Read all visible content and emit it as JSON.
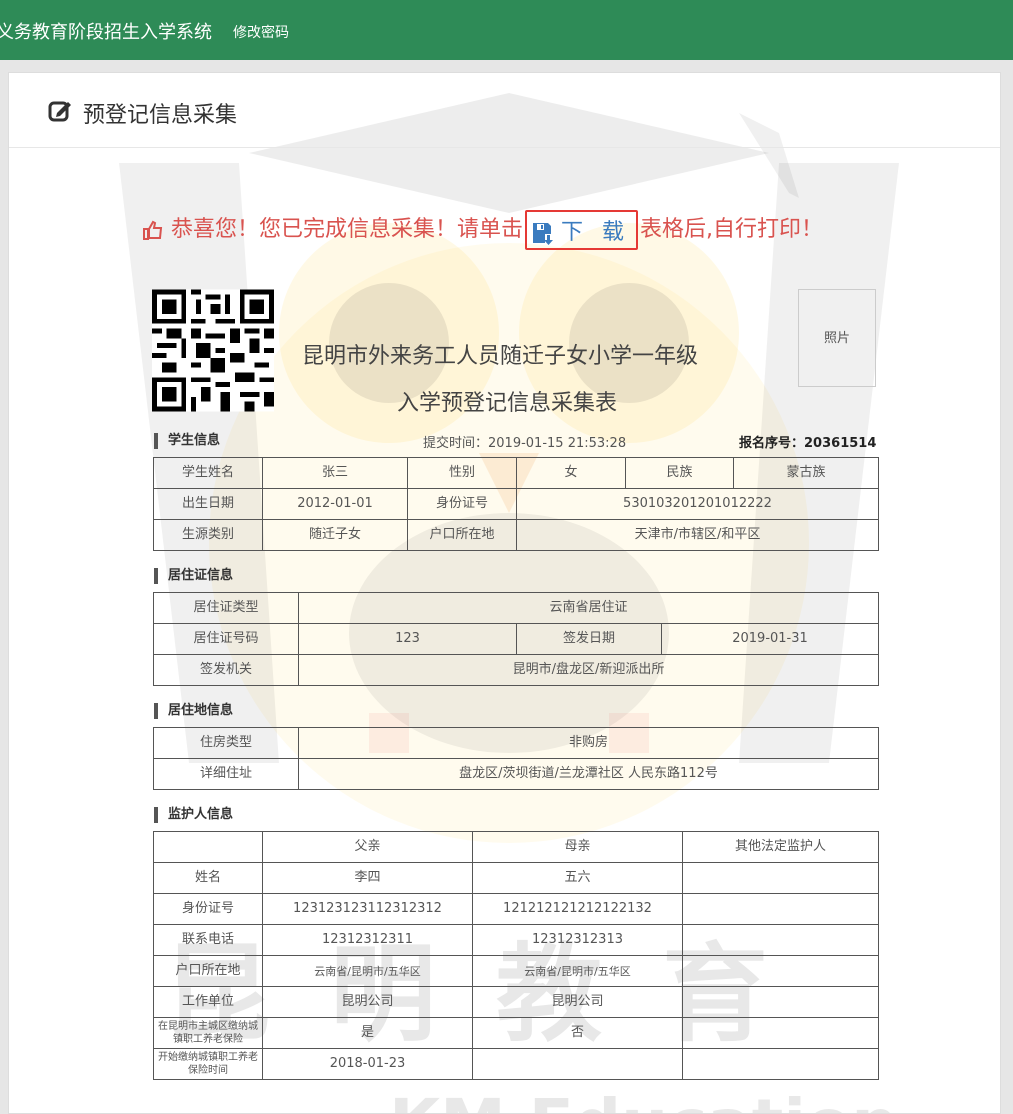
{
  "app": {
    "title": "义务教育阶段招生入学系统",
    "nav_change_password": "修改密码"
  },
  "panel": {
    "title": "预登记信息采集"
  },
  "notice": {
    "before": "恭喜您！您已完成信息采集！请单击",
    "download_label": "下 载",
    "after": "表格后,自行打印！"
  },
  "form": {
    "title_line1": "昆明市外来务工人员随迁子女小学一年级",
    "title_line2": "入学预登记信息采集表",
    "photo_label": "照片",
    "submit_time_label": "提交时间：",
    "submit_time": "2019-01-15 21:53:28",
    "reg_no_label": "报名序号：",
    "reg_no": "20361514"
  },
  "student": {
    "section": "学生信息",
    "name_label": "学生姓名",
    "name": "张三",
    "gender_label": "性别",
    "gender": "女",
    "ethnicity_label": "民族",
    "ethnicity": "蒙古族",
    "birth_label": "出生日期",
    "birth": "2012-01-01",
    "id_label": "身份证号",
    "id": "530103201201012222",
    "source_label": "生源类别",
    "source": "随迁子女",
    "hukou_label": "户口所在地",
    "hukou": "天津市/市辖区/和平区"
  },
  "permit": {
    "section": "居住证信息",
    "type_label": "居住证类型",
    "type": "云南省居住证",
    "number_label": "居住证号码",
    "number": "123",
    "issue_date_label": "签发日期",
    "issue_date": "2019-01-31",
    "authority_label": "签发机关",
    "authority": "昆明市/盘龙区/新迎派出所"
  },
  "residence": {
    "section": "居住地信息",
    "housing_label": "住房类型",
    "housing": "非购房",
    "address_label": "详细住址",
    "address": "盘龙区/茨坝街道/兰龙潭社区 人民东路112号"
  },
  "guardian": {
    "section": "监护人信息",
    "col_father": "父亲",
    "col_mother": "母亲",
    "col_other": "其他法定监护人",
    "rows": [
      {
        "label": "姓名",
        "father": "李四",
        "mother": "五六",
        "other": ""
      },
      {
        "label": "身份证号",
        "father": "123123123112312312",
        "mother": "121212121212122132",
        "other": ""
      },
      {
        "label": "联系电话",
        "father": "12312312311",
        "mother": "12312312313",
        "other": ""
      },
      {
        "label": "户口所在地",
        "father": "云南省/昆明市/五华区",
        "mother": "云南省/昆明市/五华区",
        "other": ""
      },
      {
        "label": "工作单位",
        "father": "昆明公司",
        "mother": "昆明公司",
        "other": ""
      },
      {
        "label": "在昆明市主城区缴纳城镇职工养老保险",
        "father": "是",
        "mother": "否",
        "other": ""
      },
      {
        "label": "开始缴纳城镇职工养老保险时间",
        "father": "2018-01-23",
        "mother": "",
        "other": ""
      }
    ]
  },
  "watermark": {
    "cn": "昆明教育",
    "en": "KM Education"
  },
  "colors": {
    "topbar": "#2e8b57",
    "notice": "#d9534f",
    "download": "#3a7bbf",
    "download_border": "#e53935"
  }
}
